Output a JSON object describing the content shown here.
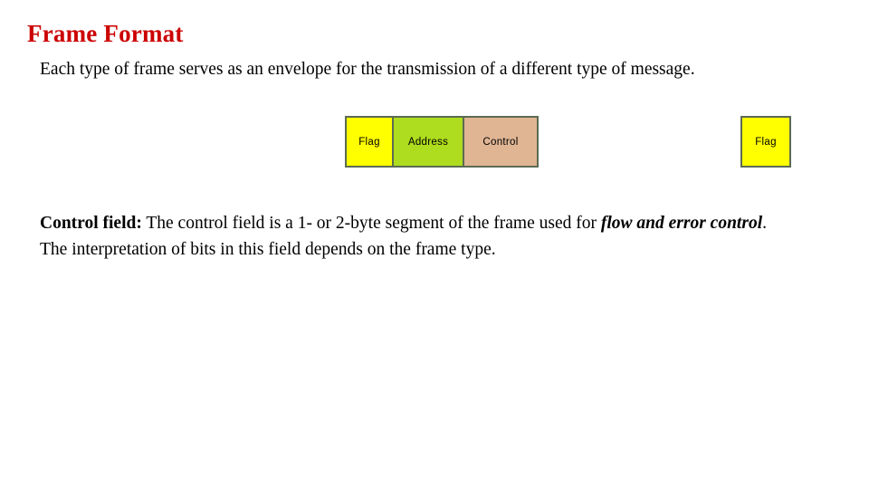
{
  "slide": {
    "title": "Frame Format",
    "title_color": "#CC0000",
    "background_color": "#FFFFFF",
    "intro_paragraph": "Each type of frame serves as an envelope for the transmission of a different type of message.",
    "body": {
      "lead_label": "Control field:",
      "lead_text": " The control field is a 1- or 2-byte segment of the frame used for ",
      "emphasis": "flow and error control",
      "emphasis_trailing": ".",
      "closing_line": "The interpretation of bits in this field depends on the frame type."
    },
    "frame_diagram": {
      "cells": [
        {
          "label": "Flag",
          "fill": "#FFFF00"
        },
        {
          "label": "Address",
          "fill": "#AEDC1E"
        },
        {
          "label": "Control",
          "fill": "#E0B594"
        }
      ],
      "trailing_flag": {
        "label": "Flag",
        "fill": "#FFFF00"
      },
      "border_color": "#5C6B52"
    }
  }
}
